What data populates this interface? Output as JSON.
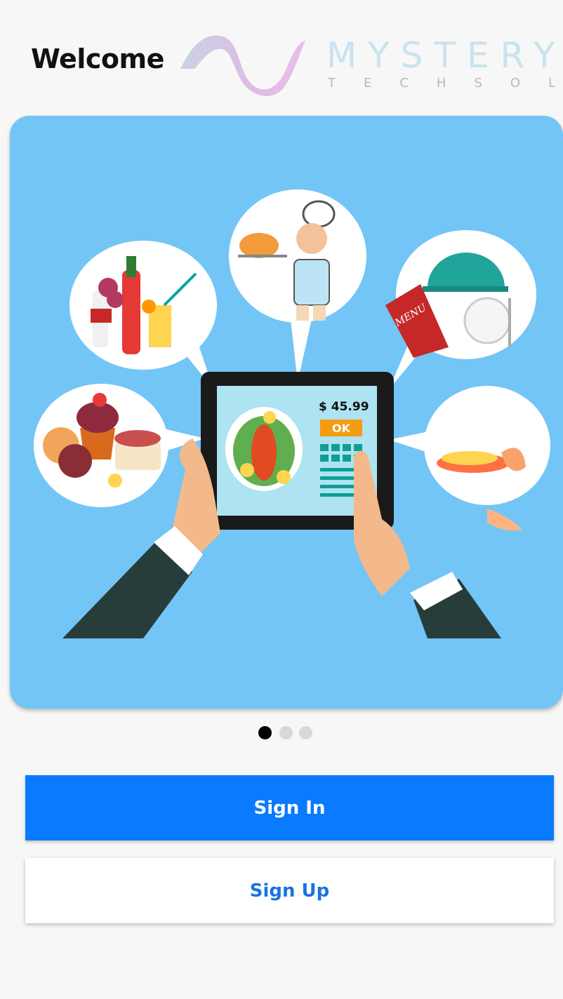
{
  "header": {
    "title": "Welcome",
    "logo_main": "MYSTERY",
    "logo_sub": "TECHSOL"
  },
  "hero": {
    "price": "$ 45.99",
    "ok": "OK",
    "menu": "MENU"
  },
  "pager": {
    "count": 3,
    "active": 0
  },
  "actions": {
    "sign_in": "Sign In",
    "sign_up": "Sign Up"
  },
  "colors": {
    "primary": "#0a7afe",
    "hero_bg": "#73c5f6",
    "signup_text": "#1a73e0"
  }
}
